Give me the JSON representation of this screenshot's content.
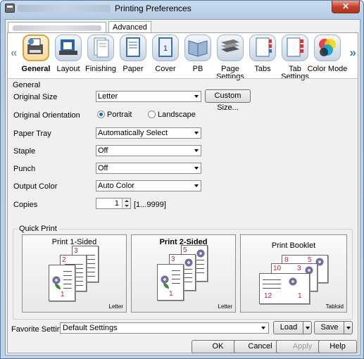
{
  "window": {
    "title": "Printing Preferences",
    "close_glyph": "✕"
  },
  "tabs": {
    "advanced": "Advanced"
  },
  "iconbar": {
    "items": [
      {
        "label": "General",
        "icon": "general-icon",
        "selected": true
      },
      {
        "label": "Layout",
        "icon": "layout-icon"
      },
      {
        "label": "Finishing",
        "icon": "finishing-icon"
      },
      {
        "label": "Paper",
        "icon": "paper-icon"
      },
      {
        "label": "Cover",
        "icon": "cover-icon"
      },
      {
        "label": "PB",
        "icon": "perfect-binding-icon"
      },
      {
        "label": "Page Settings",
        "icon": "page-settings-icon"
      },
      {
        "label": "Tabs",
        "icon": "tabs-icon"
      },
      {
        "label": "Tab Settings",
        "icon": "tab-settings-icon"
      },
      {
        "label": "Color Mode",
        "icon": "color-mode-icon"
      }
    ],
    "left_arrow": "«",
    "right_arrow": "»"
  },
  "general": {
    "group_label": "General",
    "original_size": {
      "label": "Original Size",
      "value": "Letter",
      "button": "Custom Size..."
    },
    "orientation": {
      "label": "Original Orientation",
      "portrait": "Portrait",
      "landscape": "Landscape",
      "selected": "Portrait"
    },
    "paper_tray": {
      "label": "Paper Tray",
      "value": "Automatically Select"
    },
    "staple": {
      "label": "Staple",
      "value": "Off"
    },
    "punch": {
      "label": "Punch",
      "value": "Off"
    },
    "output_color": {
      "label": "Output Color",
      "value": "Auto Color"
    },
    "copies": {
      "label": "Copies",
      "value": "1",
      "range": "[1...9999]"
    }
  },
  "quick_print": {
    "label": "Quick Print",
    "items": [
      {
        "caption": "Print 1-Sided",
        "size": "Letter"
      },
      {
        "caption": "Print 2-Sided",
        "size": "Letter",
        "selected": true
      },
      {
        "caption": "Print Booklet",
        "size": "Tabloid"
      }
    ]
  },
  "favorite": {
    "label": "Favorite Setting",
    "value": "Default Settings",
    "load": "Load",
    "save": "Save"
  },
  "buttons": {
    "ok": "OK",
    "cancel": "Cancel",
    "apply": "Apply",
    "help": "Help"
  }
}
